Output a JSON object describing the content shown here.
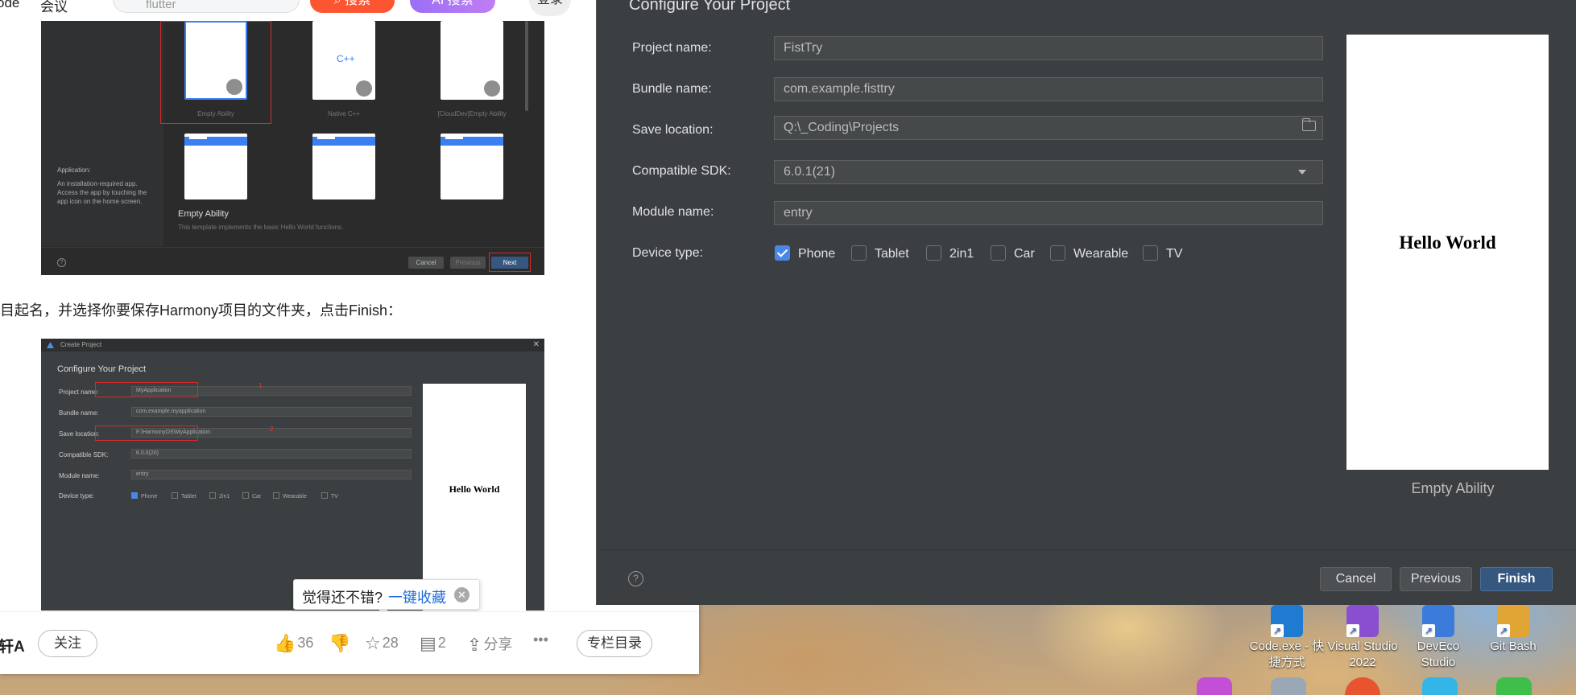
{
  "browser": {
    "top_left_text": "ode",
    "top_nav_text": "会议",
    "search_placeholder": "flutter",
    "search_button": "搜索",
    "ai_search_button": "AI 搜索",
    "login_button": "登录"
  },
  "article": {
    "paragraph": "目起名，并选择你要保存Harmony项目的文件夹，点击Finish：",
    "shot1": {
      "templates": [
        "Empty Ability",
        "Native C++",
        "[CloudDev]Empty Ability"
      ],
      "app_heading": "Application:",
      "app_desc": "An installation-required app. Access the app by touching the app icon on the home screen.",
      "selected_title": "Empty Ability",
      "selected_desc": "This template implements the basic Hello World functions.",
      "cancel": "Cancel",
      "previous": "Previous",
      "next": "Next"
    },
    "shot2": {
      "window_title": "Create Project",
      "heading": "Configure Your Project",
      "labels": [
        "Project name:",
        "Bundle name:",
        "Save location:",
        "Compatible SDK:",
        "Module name:",
        "Device type:"
      ],
      "values": [
        "MyApplication",
        "com.example.myapplication",
        "F:\\HarmonyOS\\MyApplication",
        "6.0.0(20)",
        "entry"
      ],
      "marker1": "1",
      "marker2": "2",
      "devices": [
        "Phone",
        "Tablet",
        "2in1",
        "Car",
        "Wearable",
        "TV"
      ],
      "preview_text": "Hello World"
    }
  },
  "toast": {
    "question": "觉得还不错?",
    "action": "一键收藏"
  },
  "bottom_bar": {
    "author": "轩A",
    "follow": "关注",
    "likes": "36",
    "favorites": "28",
    "comments": "2",
    "share": "分享",
    "more": "•••",
    "column_dir": "专栏目录"
  },
  "dialog": {
    "title": "Configure Your Project",
    "project_name_label": "Project name:",
    "project_name": "FistTry",
    "bundle_name_label": "Bundle name:",
    "bundle_name": "com.example.fisttry",
    "save_location_label": "Save location:",
    "save_location": "Q:\\_Coding\\Projects",
    "sdk_label": "Compatible SDK:",
    "sdk": "6.0.1(21)",
    "module_name_label": "Module name:",
    "module_name": "entry",
    "device_type_label": "Device type:",
    "devices": [
      {
        "label": "Phone",
        "checked": true
      },
      {
        "label": "Tablet",
        "checked": false
      },
      {
        "label": "2in1",
        "checked": false
      },
      {
        "label": "Car",
        "checked": false
      },
      {
        "label": "Wearable",
        "checked": false
      },
      {
        "label": "TV",
        "checked": false
      }
    ],
    "preview_text": "Hello World",
    "preview_caption": "Empty Ability",
    "help": "?",
    "cancel": "Cancel",
    "previous": "Previous",
    "finish": "Finish"
  },
  "desktop_icons": [
    {
      "label": "Code.exe - 快捷方式",
      "icon": "vscode-shortcut-icon"
    },
    {
      "label": "Visual Studio 2022",
      "icon": "visual-studio-icon"
    },
    {
      "label": "DevEco Studio",
      "icon": "deveco-studio-icon"
    },
    {
      "label": "Git Bash",
      "icon": "git-bash-icon"
    }
  ],
  "colors": {
    "dialog_bg": "#3c3f41",
    "primary_button": "#365880",
    "checkbox_on": "#4a86e8",
    "search_red": "#fc5531",
    "link_blue": "#1e6fd9"
  }
}
